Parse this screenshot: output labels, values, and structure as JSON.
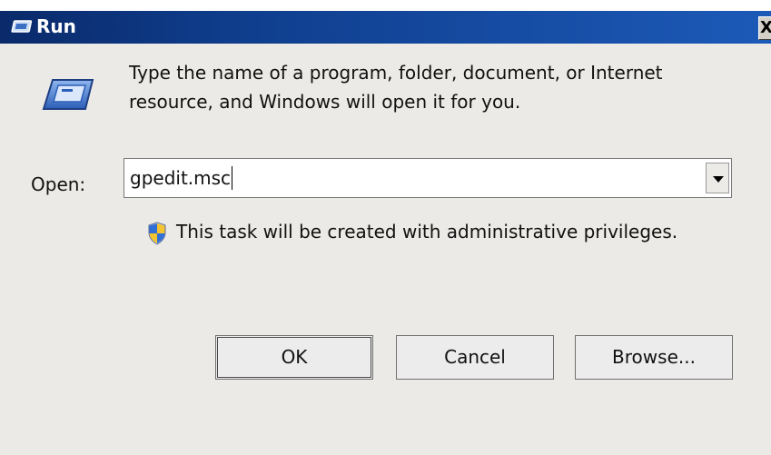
{
  "window": {
    "title": "Run",
    "close_glyph": "X"
  },
  "icons": {
    "title_icon": "run-icon",
    "main_icon": "run-icon",
    "shield_icon": "uac-shield-icon"
  },
  "description": {
    "line1": "Type the name of a program, folder, document, or Internet",
    "line2": "resource, and Windows will open it for you."
  },
  "open": {
    "label": "Open:",
    "value": "gpedit.msc"
  },
  "admin_note": "This task will be created with administrative privileges.",
  "buttons": {
    "ok": "OK",
    "cancel": "Cancel",
    "browse": "Browse..."
  },
  "colors": {
    "titlebar": "#0f3d8c",
    "dialog_bg": "#eceae6"
  }
}
